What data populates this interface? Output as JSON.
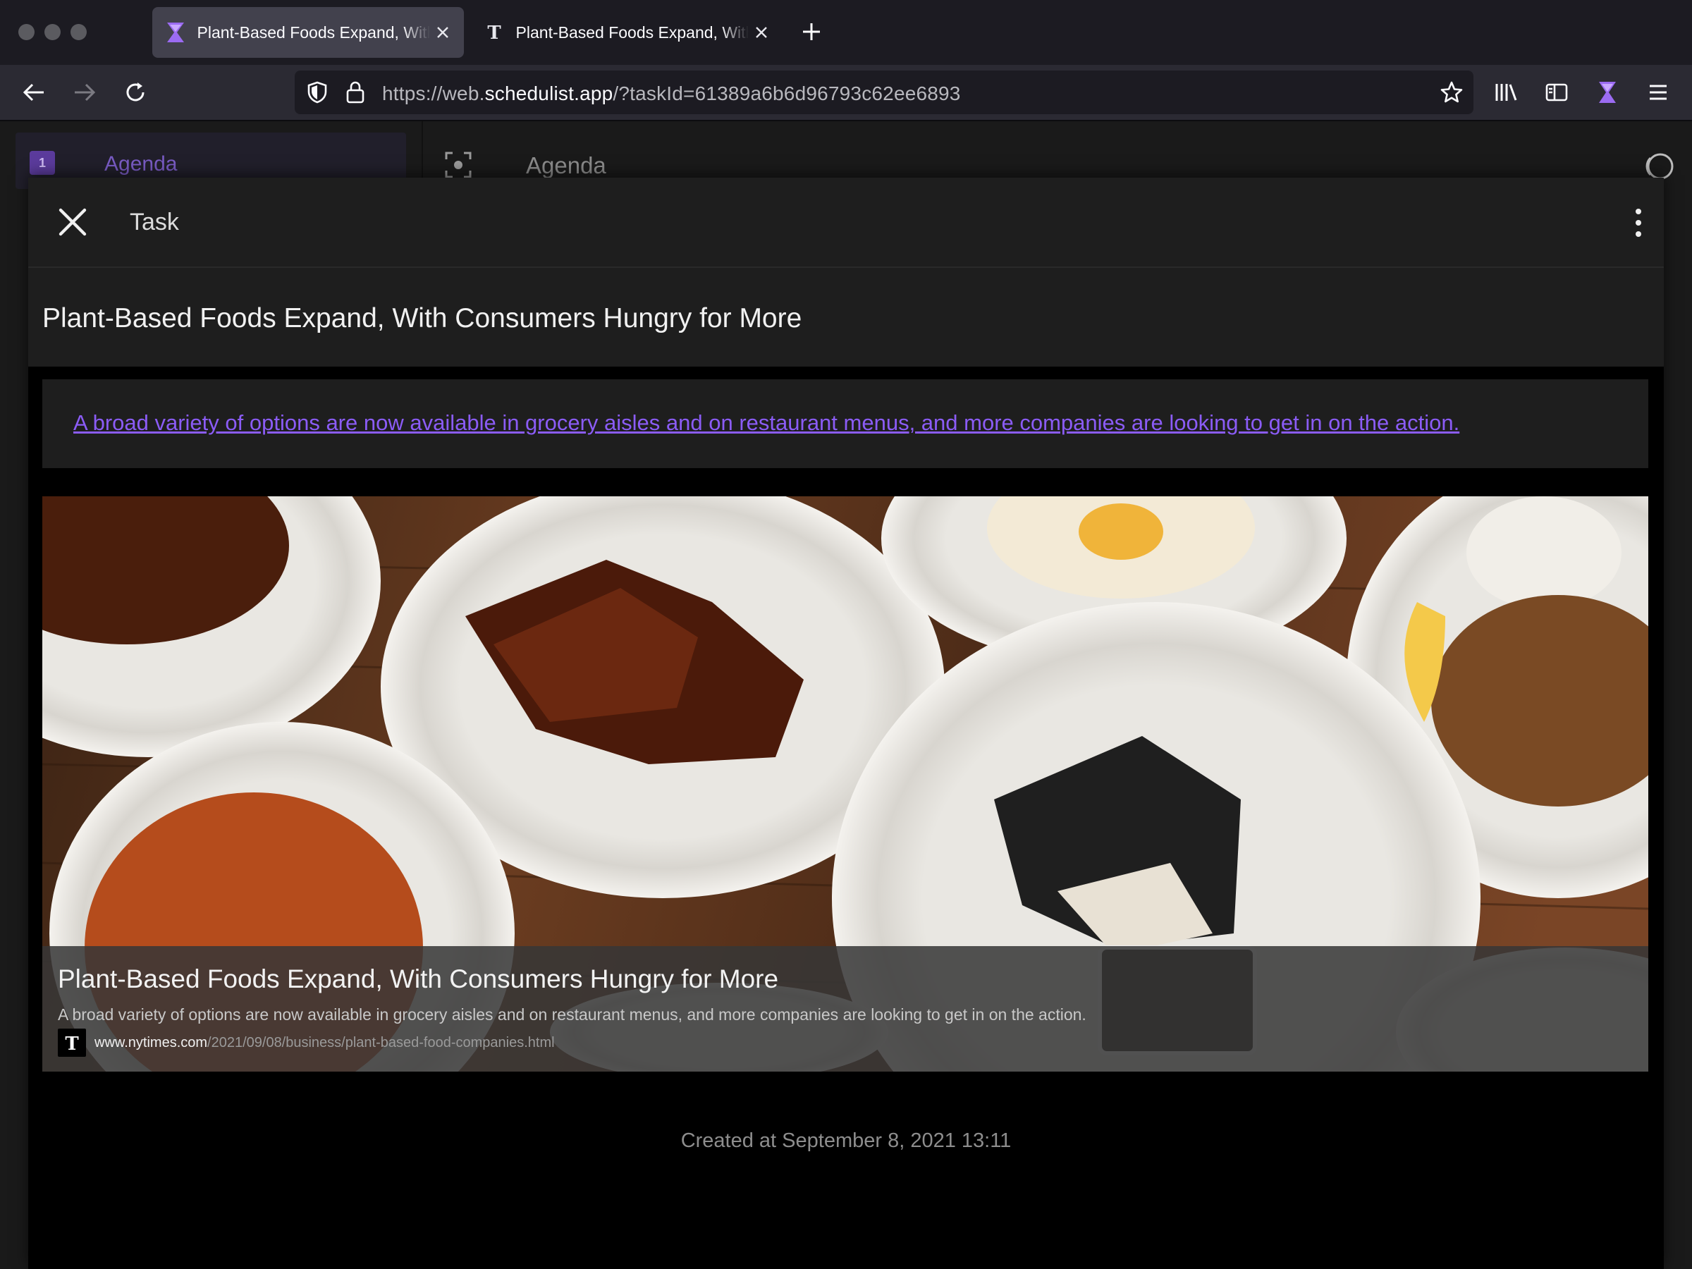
{
  "browser": {
    "tabs": [
      {
        "title": "Plant-Based Foods Expand, With Consumers Hungry for More",
        "active": true,
        "favicon": "schedulist-icon"
      },
      {
        "title": "Plant-Based Foods Expand, With Consumers Hungry for More",
        "active": false,
        "favicon": "nytimes-icon"
      }
    ],
    "url": {
      "prefix": "https://web.",
      "domain": "schedulist.app",
      "suffix": "/?taskId=61389a6b6d96793c62ee6893"
    }
  },
  "sidebar": {
    "items": [
      {
        "badge": "1",
        "label": "Agenda"
      }
    ]
  },
  "main": {
    "title": "Agenda"
  },
  "modal": {
    "label": "Task",
    "task_title": "Plant-Based Foods Expand, With Consumers Hungry for More",
    "link_text": "A broad variety of options are now available in grocery aisles and on restaurant menus, and more companies are looking to get in on the action.",
    "preview": {
      "title": "Plant-Based Foods Expand, With Consumers Hungry for More",
      "description": "A broad variety of options are now available in grocery aisles and on restaurant menus, and more companies are looking to get in on the action.",
      "domain": "www.nytimes.com",
      "path": "/2021/09/08/business/plant-based-food-companies.html",
      "image": "plant-based dishes on plates over a wooden table"
    },
    "created": "Created at September 8, 2021 13:11"
  },
  "colors": {
    "accent": "#8b5cf6",
    "chrome": "#1c1b22",
    "toolbar": "#2b2a33",
    "panel": "#1e1e1e"
  }
}
